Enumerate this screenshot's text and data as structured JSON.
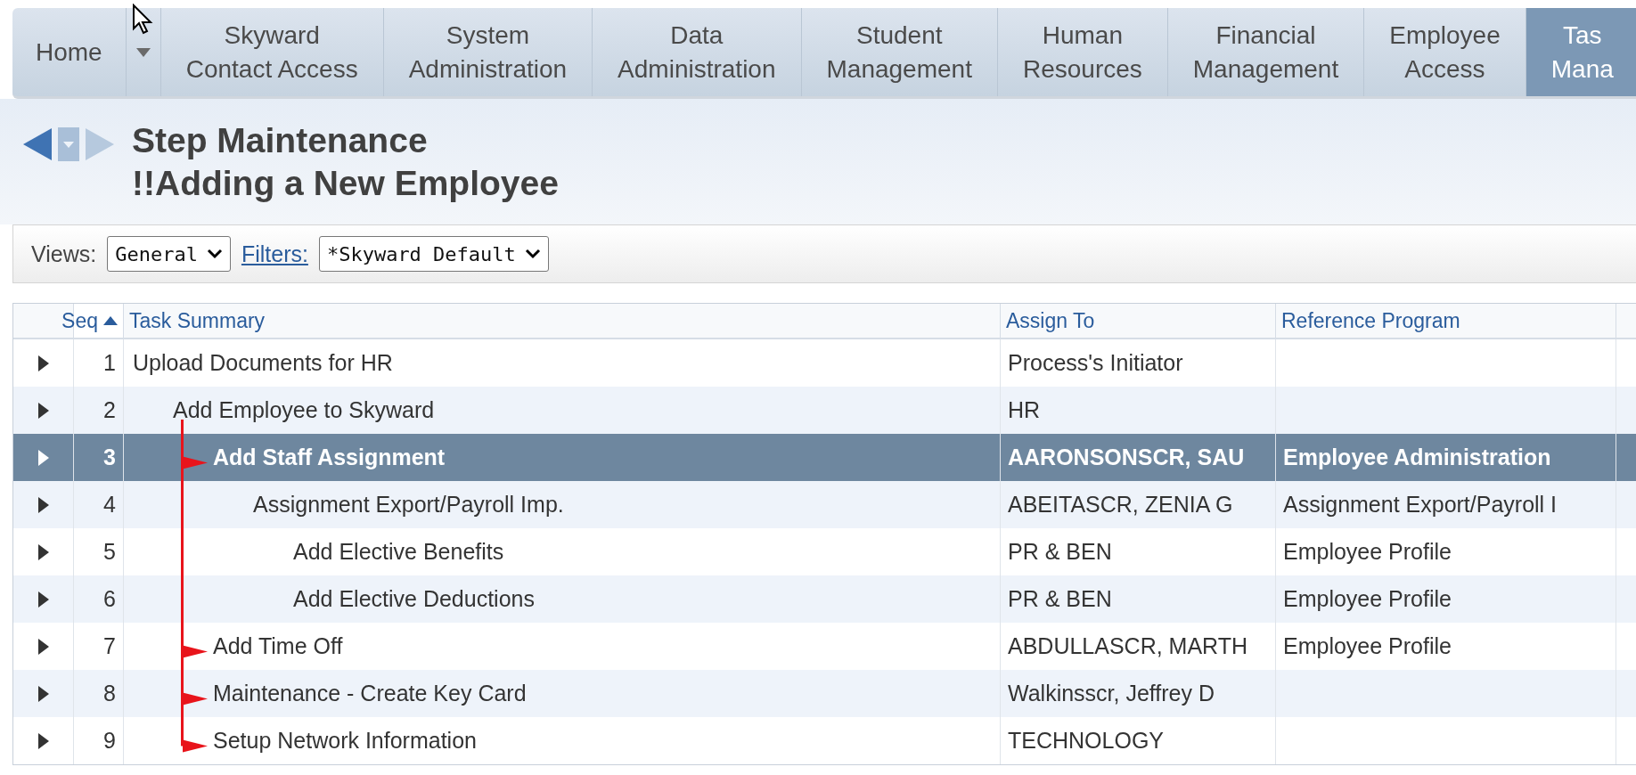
{
  "nav_tabs": [
    {
      "lines": [
        "Home"
      ],
      "selected": false,
      "menu": true
    },
    {
      "lines": [
        "Skyward",
        "Contact Access"
      ],
      "selected": false
    },
    {
      "lines": [
        "System",
        "Administration"
      ],
      "selected": false
    },
    {
      "lines": [
        "Data",
        "Administration"
      ],
      "selected": false
    },
    {
      "lines": [
        "Student",
        "Management"
      ],
      "selected": false
    },
    {
      "lines": [
        "Human",
        "Resources"
      ],
      "selected": false
    },
    {
      "lines": [
        "Financial",
        "Management"
      ],
      "selected": false
    },
    {
      "lines": [
        "Employee",
        "Access"
      ],
      "selected": false
    },
    {
      "lines": [
        "Tas",
        "Mana"
      ],
      "selected": true
    }
  ],
  "page": {
    "title": "Step Maintenance",
    "subtitle": "!!Adding a New Employee"
  },
  "toolbar": {
    "views_label": "Views:",
    "views_value": "General",
    "filters_link": "Filters:",
    "filters_value": "*Skyward Default"
  },
  "table": {
    "columns": [
      {
        "label": "Seq",
        "sorted": true
      },
      {
        "label": "Task Summary",
        "sorted": false
      },
      {
        "label": "Assign To",
        "sorted": false
      },
      {
        "label": "Reference Program",
        "sorted": false
      }
    ],
    "rows": [
      {
        "seq": "1",
        "task": "Upload Documents for HR",
        "assign_to": "Process's Initiator",
        "selected": false,
        "marked": false,
        "children": [
          {
            "seq": "2",
            "task": "Add Employee to Skyward",
            "assign_to": "HR",
            "selected": false,
            "marked": false,
            "children": [
              {
                "seq": "3",
                "task": "Add Staff Assignment",
                "assign_to": "AARONSONSCR, SAU",
                "reference_program": "Employee Administration",
                "selected": true,
                "marked": true,
                "children": [
                  {
                    "seq": "4",
                    "task": "Assignment Export/Payroll Imp.",
                    "assign_to": "ABEITASCR, ZENIA G",
                    "reference_program": "Assignment Export/Payroll I",
                    "selected": false,
                    "marked": false,
                    "children": [
                      {
                        "seq": "5",
                        "task": "Add Elective Benefits",
                        "assign_to": "PR & BEN",
                        "reference_program": "Employee Profile",
                        "selected": false,
                        "marked": false
                      },
                      {
                        "seq": "6",
                        "task": "Add Elective Deductions",
                        "assign_to": "PR & BEN",
                        "reference_program": "Employee Profile",
                        "selected": false,
                        "marked": false
                      }
                    ]
                  }
                ]
              },
              {
                "seq": "7",
                "task": "Add Time Off",
                "assign_to": "ABDULLASCR, MARTH",
                "reference_program": "Employee Profile",
                "selected": false,
                "marked": true
              },
              {
                "seq": "8",
                "task": "Maintenance - Create Key Card",
                "assign_to": "Walkinsscr, Jeffrey D",
                "selected": false,
                "marked": true
              },
              {
                "seq": "9",
                "task": "Setup Network Information",
                "assign_to": "TECHNOLOGY",
                "selected": false,
                "marked": true
              }
            ]
          }
        ]
      }
    ]
  }
}
